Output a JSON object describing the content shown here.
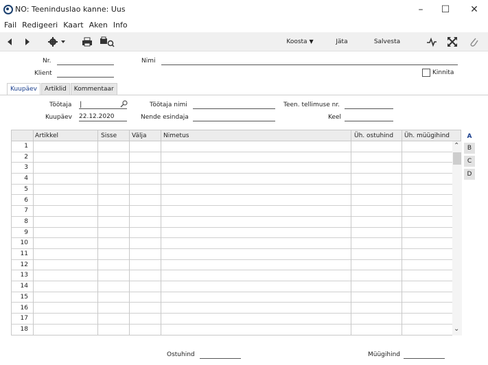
{
  "window": {
    "title": "NO: Teeninduslao kanne: Uus",
    "minimize": "–",
    "maximize": "☐",
    "close": "✕"
  },
  "menu": [
    "Fail",
    "Redigeeri",
    "Kaart",
    "Aken",
    "Info"
  ],
  "toolbar": {
    "koosta": "Koosta",
    "jata": "Jäta",
    "salvesta": "Salvesta"
  },
  "header": {
    "nr_label": "Nr.",
    "nr_value": "",
    "klient_label": "Klient",
    "klient_value": "",
    "nimi_label": "Nimi",
    "nimi_value": "",
    "kinnita_label": "Kinnita",
    "kinnita_checked": false
  },
  "tabs": [
    "Kuupäev",
    "Artiklid",
    "Kommentaar"
  ],
  "form": {
    "tootaja_label": "Töötaja",
    "tootaja_value": "",
    "tootaja_nimi_label": "Töötaja nimi",
    "tootaja_nimi_value": "",
    "teen_tellimuse_label": "Teen. tellimuse nr.",
    "teen_tellimuse_value": "",
    "kuupaev_label": "Kuupäev",
    "kuupaev_value": "22.12.2020",
    "nende_esindaja_label": "Nende esindaja",
    "nende_esindaja_value": "",
    "keel_label": "Keel",
    "keel_value": ""
  },
  "grid": {
    "columns": [
      "Artikkel",
      "Sisse",
      "Välja",
      "Nimetus",
      "Üh. ostuhind",
      "Üh. müügihind"
    ],
    "rows": [
      "1",
      "2",
      "3",
      "4",
      "5",
      "6",
      "7",
      "8",
      "9",
      "10",
      "11",
      "12",
      "13",
      "14",
      "15",
      "16",
      "17",
      "18"
    ]
  },
  "side_tabs": [
    "A",
    "B",
    "C",
    "D"
  ],
  "footer": {
    "ostuhind_label": "Ostuhind",
    "ostuhind_value": "",
    "muugihind_label": "Müügihind",
    "muugihind_value": ""
  }
}
